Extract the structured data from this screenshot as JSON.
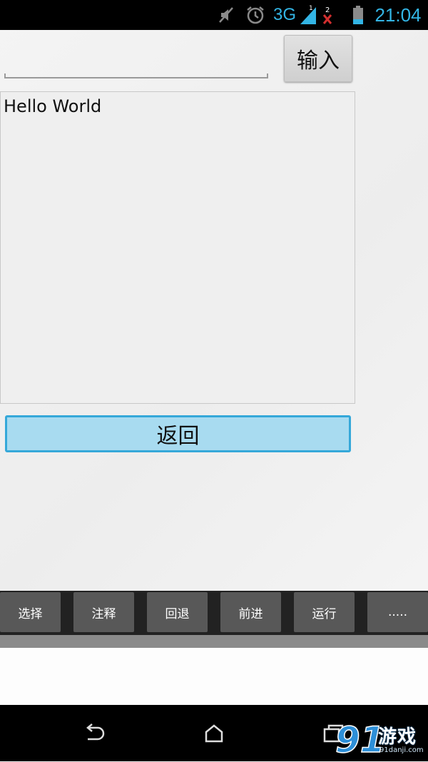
{
  "status_bar": {
    "network": "3G",
    "sim_badge": "2",
    "signal_badge": "1",
    "time": "21:04",
    "icons": [
      "mute-icon",
      "alarm-icon",
      "signal-icon",
      "sim-error-icon",
      "battery-icon"
    ],
    "accent_color": "#33b5e5"
  },
  "editor": {
    "input_value": "",
    "enter_label": "输入",
    "text_content": "Hello World",
    "back_label": "返回"
  },
  "toolbar": {
    "items": [
      {
        "label": "选择"
      },
      {
        "label": "注释"
      },
      {
        "label": "回退"
      },
      {
        "label": "前进"
      },
      {
        "label": "运行"
      },
      {
        "label": "....."
      }
    ]
  },
  "nav": {
    "icons": [
      "back-nav-icon",
      "home-nav-icon",
      "recents-nav-icon"
    ]
  },
  "watermark": {
    "logo": "91",
    "text": "游戏",
    "url": "91danji.com"
  },
  "colors": {
    "button_blue_fill": "#a8dbf0",
    "button_blue_border": "#35a8d9",
    "toolbar_button": "#585858"
  }
}
